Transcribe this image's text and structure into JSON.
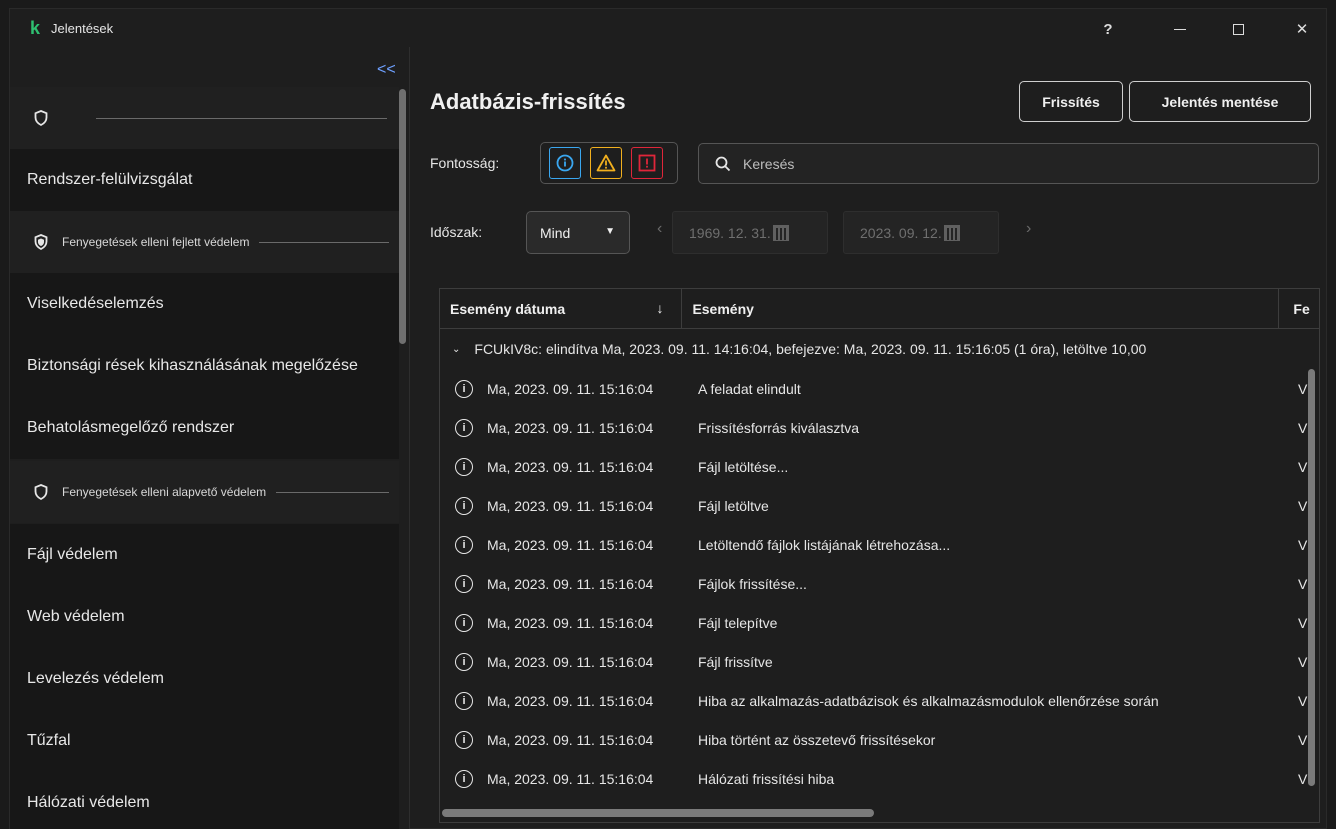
{
  "window": {
    "title": "Jelentések",
    "help": "?",
    "minimize_icon": "minimize-icon",
    "maximize_icon": "maximize-icon",
    "close": "✕"
  },
  "sidebar": {
    "collapse": "<<",
    "sections": [
      {
        "label": "",
        "icon": "shield-icon"
      },
      {
        "label": "Fenyegetések elleni fejlett védelem",
        "icon": "shield-advanced-icon"
      },
      {
        "label": "Fenyegetések elleni alapvető védelem",
        "icon": "shield-icon"
      }
    ],
    "items": [
      "Rendszer-felülvizsgálat",
      "Viselkedéselemzés",
      "Biztonsági rések kihasználásának megelőzése",
      "Behatolásmegelőző rendszer",
      "Fájl védelem",
      "Web védelem",
      "Levelezés védelem",
      "Tűzfal",
      "Hálózati védelem"
    ]
  },
  "main": {
    "title": "Adatbázis-frissítés",
    "refresh_label": "Frissítés",
    "save_label": "Jelentés mentése",
    "importance_label": "Fontosság:",
    "search_placeholder": "Keresés",
    "period_label": "Időszak:",
    "period_value": "Mind",
    "date_from": "1969. 12. 31.",
    "date_to": "2023. 09. 12.",
    "accent_colors": {
      "info": "#3aa7f0",
      "warning": "#f2b01e",
      "error": "#e0263a"
    }
  },
  "table": {
    "columns": [
      "Esemény dátuma",
      "Esemény",
      "Fe"
    ],
    "sort_indicator": "↓",
    "group": "FCUkIV8c: elindítva Ma, 2023. 09. 11. 14:16:04, befejezve: Ma, 2023. 09. 11. 15:16:05 (1 óra), letöltve 10,00",
    "rows": [
      {
        "date": "Ma, 2023. 09. 11. 15:16:04",
        "event": "A feladat elindult",
        "imp": "V"
      },
      {
        "date": "Ma, 2023. 09. 11. 15:16:04",
        "event": "Frissítésforrás kiválasztva",
        "imp": "V"
      },
      {
        "date": "Ma, 2023. 09. 11. 15:16:04",
        "event": "Fájl letöltése...",
        "imp": "V"
      },
      {
        "date": "Ma, 2023. 09. 11. 15:16:04",
        "event": "Fájl letöltve",
        "imp": "V"
      },
      {
        "date": "Ma, 2023. 09. 11. 15:16:04",
        "event": "Letöltendő fájlok listájának létrehozása...",
        "imp": "V"
      },
      {
        "date": "Ma, 2023. 09. 11. 15:16:04",
        "event": "Fájlok frissítése...",
        "imp": "V"
      },
      {
        "date": "Ma, 2023. 09. 11. 15:16:04",
        "event": "Fájl telepítve",
        "imp": "V"
      },
      {
        "date": "Ma, 2023. 09. 11. 15:16:04",
        "event": "Fájl frissítve",
        "imp": "V"
      },
      {
        "date": "Ma, 2023. 09. 11. 15:16:04",
        "event": "Hiba az alkalmazás-adatbázisok és alkalmazásmodulok ellenőrzése során",
        "imp": "V"
      },
      {
        "date": "Ma, 2023. 09. 11. 15:16:04",
        "event": "Hiba történt az összetevő frissítésekor",
        "imp": "V"
      },
      {
        "date": "Ma, 2023. 09. 11. 15:16:04",
        "event": "Hálózati frissítési hiba",
        "imp": "V"
      }
    ]
  }
}
